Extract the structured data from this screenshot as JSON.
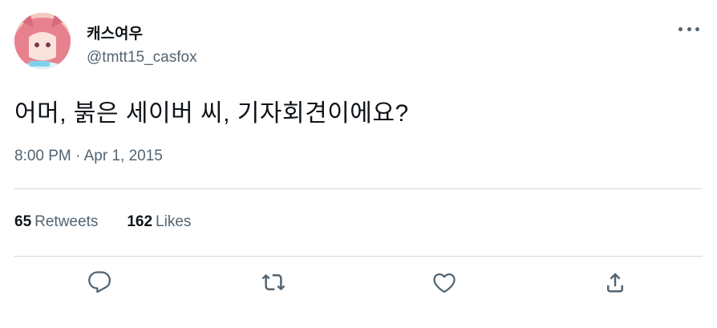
{
  "user": {
    "display_name": "캐스여우",
    "handle": "@tmtt15_casfox",
    "avatar_icon": "avatar-image"
  },
  "tweet": {
    "text": "어머, 붉은 세이버 씨, 기자회견이에요?",
    "timestamp": "8:00 PM · Apr 1, 2015"
  },
  "stats": {
    "retweets_count": "65",
    "retweets_label": "Retweets",
    "likes_count": "162",
    "likes_label": "Likes"
  },
  "actions": {
    "reply_icon": "reply-icon",
    "retweet_icon": "retweet-icon",
    "like_icon": "heart-icon",
    "share_icon": "share-icon",
    "more_icon": "more-icon"
  },
  "colors": {
    "text_primary": "#0f1419",
    "text_secondary": "#536471",
    "divider": "#cfd9de"
  }
}
